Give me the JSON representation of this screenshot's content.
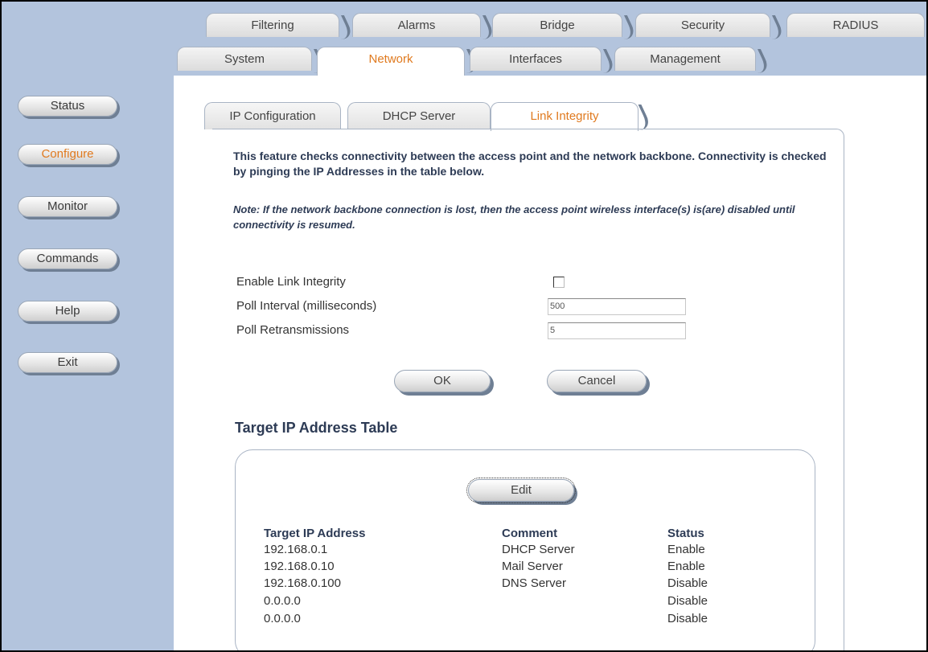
{
  "sidebar": {
    "buttons": [
      "Status",
      "Configure",
      "Monitor",
      "Commands",
      "Help",
      "Exit"
    ],
    "active": "Configure"
  },
  "top_tabs_row1": [
    "Filtering",
    "Alarms",
    "Bridge",
    "Security",
    "RADIUS"
  ],
  "top_tabs_row2": [
    "System",
    "Network",
    "Interfaces",
    "Management"
  ],
  "active_top_tab": "Network",
  "inner_tabs": [
    "IP Configuration",
    "DHCP Server",
    "Link Integrity"
  ],
  "active_inner_tab": "Link Integrity",
  "description": "This feature checks connectivity between the access point and the network backbone. Connectivity is checked by pinging the IP Addresses in the table below.",
  "note": "Note: If the network backbone connection is lost, then the access point wireless interface(s) is(are) disabled until connectivity is resumed.",
  "form": {
    "enable_label": "Enable Link Integrity",
    "enable_checked": false,
    "poll_interval_label": "Poll Interval (milliseconds)",
    "poll_interval_value": "500",
    "poll_retrans_label": "Poll Retransmissions",
    "poll_retrans_value": "5",
    "ok_label": "OK",
    "cancel_label": "Cancel"
  },
  "table": {
    "title": "Target IP Address Table",
    "edit_label": "Edit",
    "headers": [
      "Target IP Address",
      "Comment",
      "Status"
    ],
    "rows": [
      [
        "192.168.0.1",
        "DHCP Server",
        "Enable"
      ],
      [
        "192.168.0.10",
        "Mail Server",
        "Enable"
      ],
      [
        "192.168.0.100",
        "DNS Server",
        "Disable"
      ],
      [
        "0.0.0.0",
        "",
        "Disable"
      ],
      [
        "0.0.0.0",
        "",
        "Disable"
      ]
    ]
  },
  "colors": {
    "sidebar_bg": "#b3c4dd",
    "active_text": "#e07a1f",
    "heading_text": "#2d3b55"
  }
}
